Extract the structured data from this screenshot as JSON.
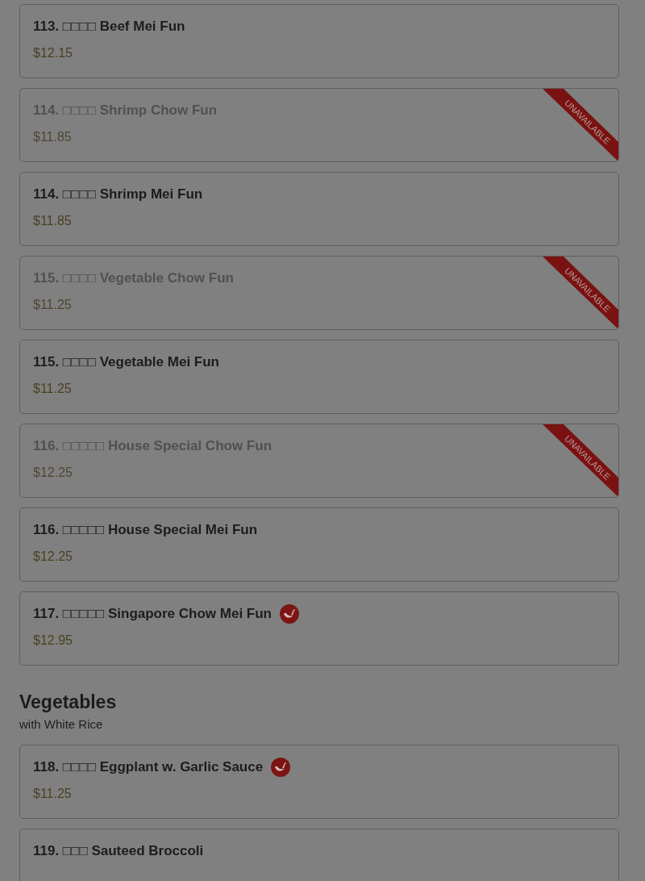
{
  "sections": [
    {
      "items": [
        {
          "title": "113. □□□□ Beef Mei Fun",
          "price": "$12.15",
          "available": true,
          "spicy": false
        },
        {
          "title": "114. □□□□ Shrimp Chow Fun",
          "price": "$11.85",
          "available": false,
          "ribbon": "UNAVAILABLE",
          "spicy": false
        },
        {
          "title": "114. □□□□ Shrimp Mei Fun",
          "price": "$11.85",
          "available": true,
          "spicy": false
        },
        {
          "title": "115. □□□□ Vegetable Chow Fun",
          "price": "$11.25",
          "available": false,
          "ribbon": "UNAVAILABLE",
          "spicy": false
        },
        {
          "title": "115. □□□□ Vegetable Mei Fun",
          "price": "$11.25",
          "available": true,
          "spicy": false
        },
        {
          "title": "116. □□□□□ House Special Chow Fun",
          "price": "$12.25",
          "available": false,
          "ribbon": "UNAVAILABLE",
          "spicy": false
        },
        {
          "title": "116. □□□□□ House Special Mei Fun",
          "price": "$12.25",
          "available": true,
          "spicy": false
        },
        {
          "title": "117. □□□□□ Singapore Chow Mei Fun",
          "price": "$12.95",
          "available": true,
          "spicy": true
        }
      ]
    },
    {
      "heading": "Vegetables",
      "subtitle": "with White Rice",
      "items": [
        {
          "title": "118. □□□□ Eggplant w. Garlic Sauce",
          "price": "$11.25",
          "available": true,
          "spicy": true
        },
        {
          "title": "119. □□□ Sauteed Broccoli",
          "available": true,
          "spicy": false
        }
      ]
    }
  ]
}
